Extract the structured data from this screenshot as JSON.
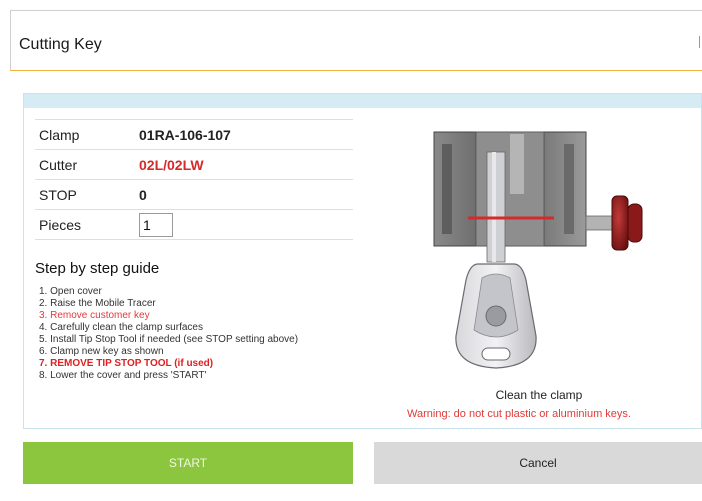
{
  "header": {
    "title": "Cutting Key"
  },
  "specs": {
    "clamp_label": "Clamp",
    "clamp_value": "01RA-106-107",
    "cutter_label": "Cutter",
    "cutter_value": "02L/02LW",
    "stop_label": "STOP",
    "stop_value": "0",
    "pieces_label": "Pieces",
    "pieces_value": "1"
  },
  "guide": {
    "title": "Step by step guide",
    "steps": [
      "1. Open cover",
      "2. Raise the Mobile Tracer",
      "3. Remove customer key",
      "4. Carefully clean the clamp surfaces",
      "5. Install Tip Stop Tool if needed (see STOP setting above)",
      "6. Clamp new key as shown",
      "7. REMOVE TIP STOP TOOL (if used)",
      "8. Lower the cover and press 'START'"
    ]
  },
  "illustration": {
    "caption": "Clean the clamp",
    "warning": "Warning: do not cut plastic or aluminium keys."
  },
  "buttons": {
    "start_label": "START",
    "cancel_label": "Cancel"
  },
  "colors": {
    "accent_orange": "#f0b43c",
    "start_green": "#8cc63f",
    "warning_red": "#e03a3a",
    "cancel_grey": "#d9d9d9"
  },
  "icons": {
    "illustration": "key-in-clamp-illustration"
  }
}
